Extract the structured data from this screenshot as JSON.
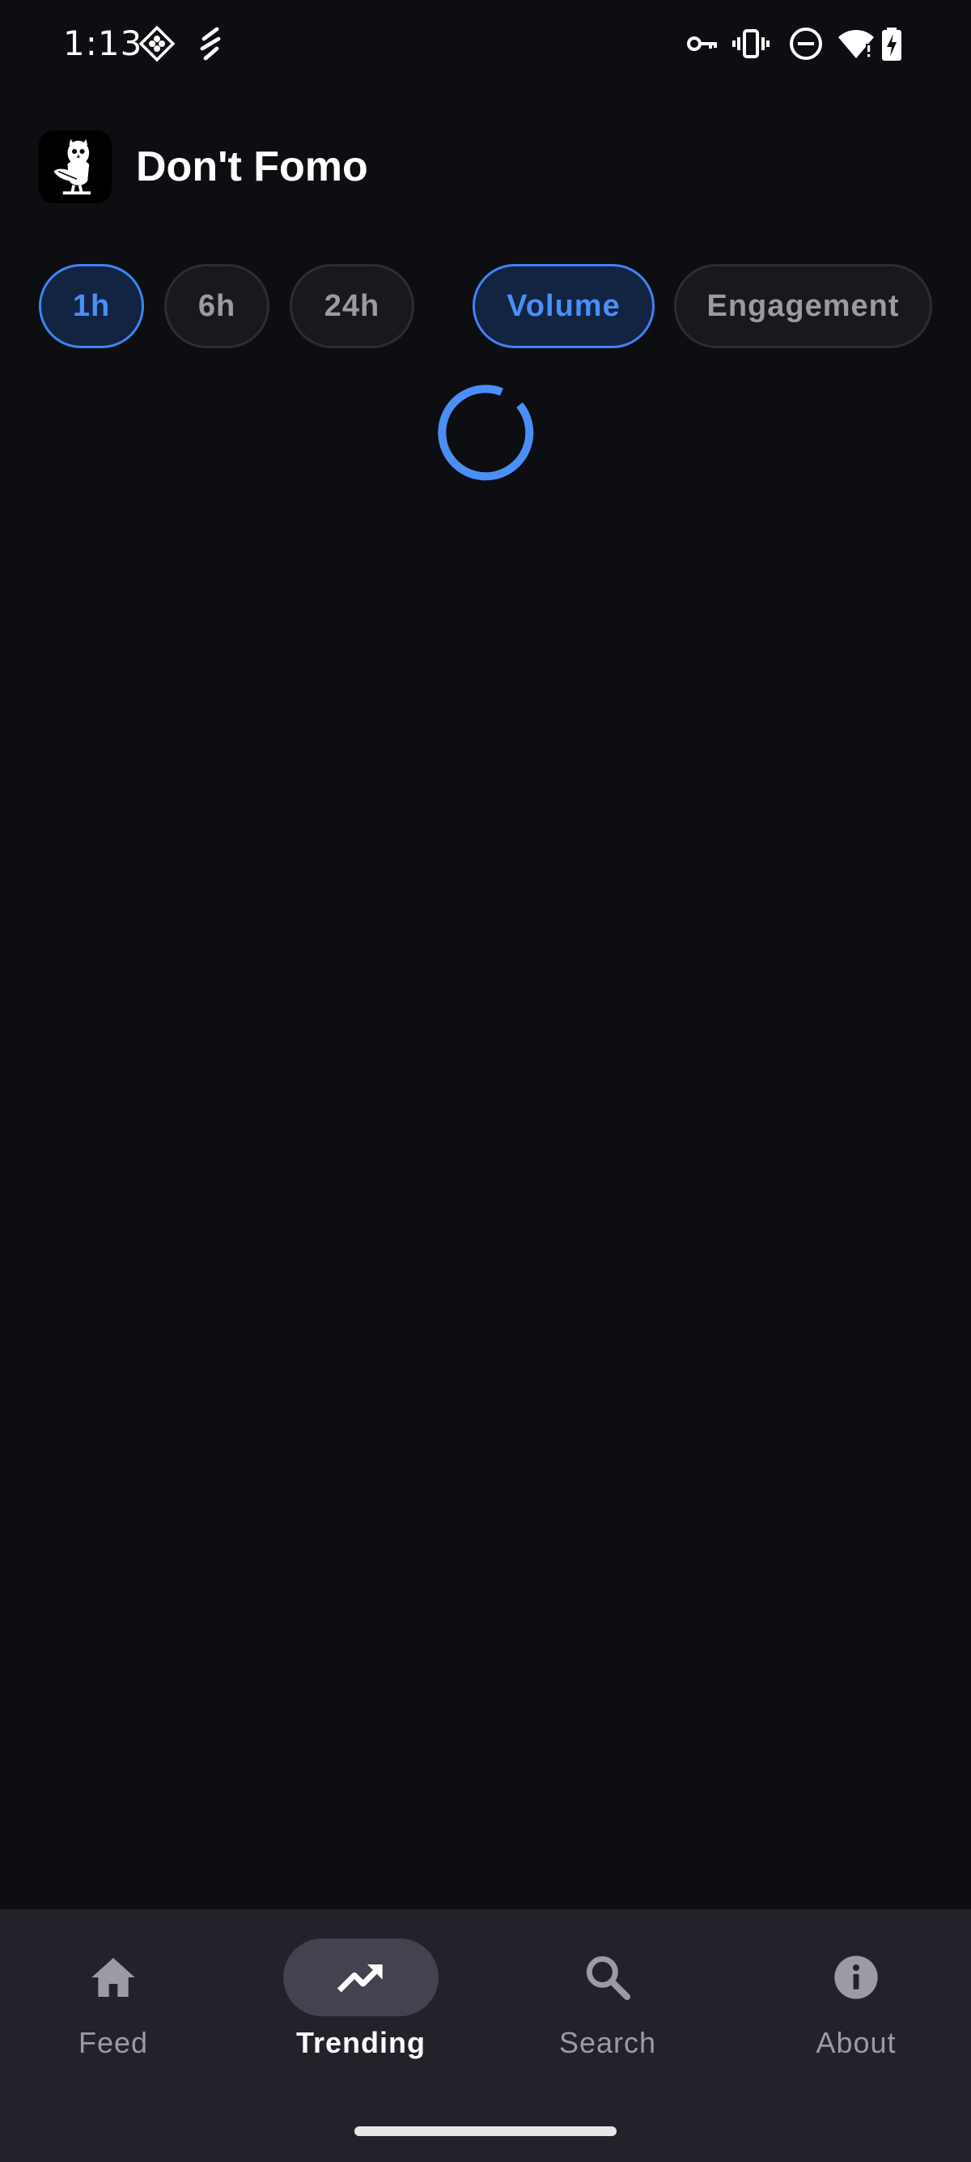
{
  "status_bar": {
    "time": "1:13",
    "icons": [
      "app-notification-icon",
      "bolt-notification-icon",
      "vpn-key-icon",
      "vibrate-icon",
      "do-not-disturb-icon",
      "wifi-icon",
      "battery-charging-icon"
    ]
  },
  "app": {
    "title": "Don't Fomo",
    "logo": "owl-logo"
  },
  "filters": {
    "time_ranges": [
      {
        "label": "1h",
        "selected": true
      },
      {
        "label": "6h",
        "selected": false
      },
      {
        "label": "24h",
        "selected": false
      }
    ],
    "sort_modes": [
      {
        "label": "Volume",
        "selected": true
      },
      {
        "label": "Engagement",
        "selected": false
      }
    ]
  },
  "content": {
    "state": "loading",
    "spinner_icon": "loading-spinner"
  },
  "bottom_nav": {
    "items": [
      {
        "label": "Feed",
        "icon": "home-icon",
        "active": false
      },
      {
        "label": "Trending",
        "icon": "trending-up-icon",
        "active": true
      },
      {
        "label": "Search",
        "icon": "search-icon",
        "active": false
      },
      {
        "label": "About",
        "icon": "info-icon",
        "active": false
      }
    ]
  },
  "colors": {
    "background": "#0d0e11",
    "accent": "#4a8ff5",
    "chip_selected_bg": "#132342",
    "nav_background": "#22232a",
    "nav_active_pill": "#43424f",
    "muted_text": "#9a9ba3"
  }
}
